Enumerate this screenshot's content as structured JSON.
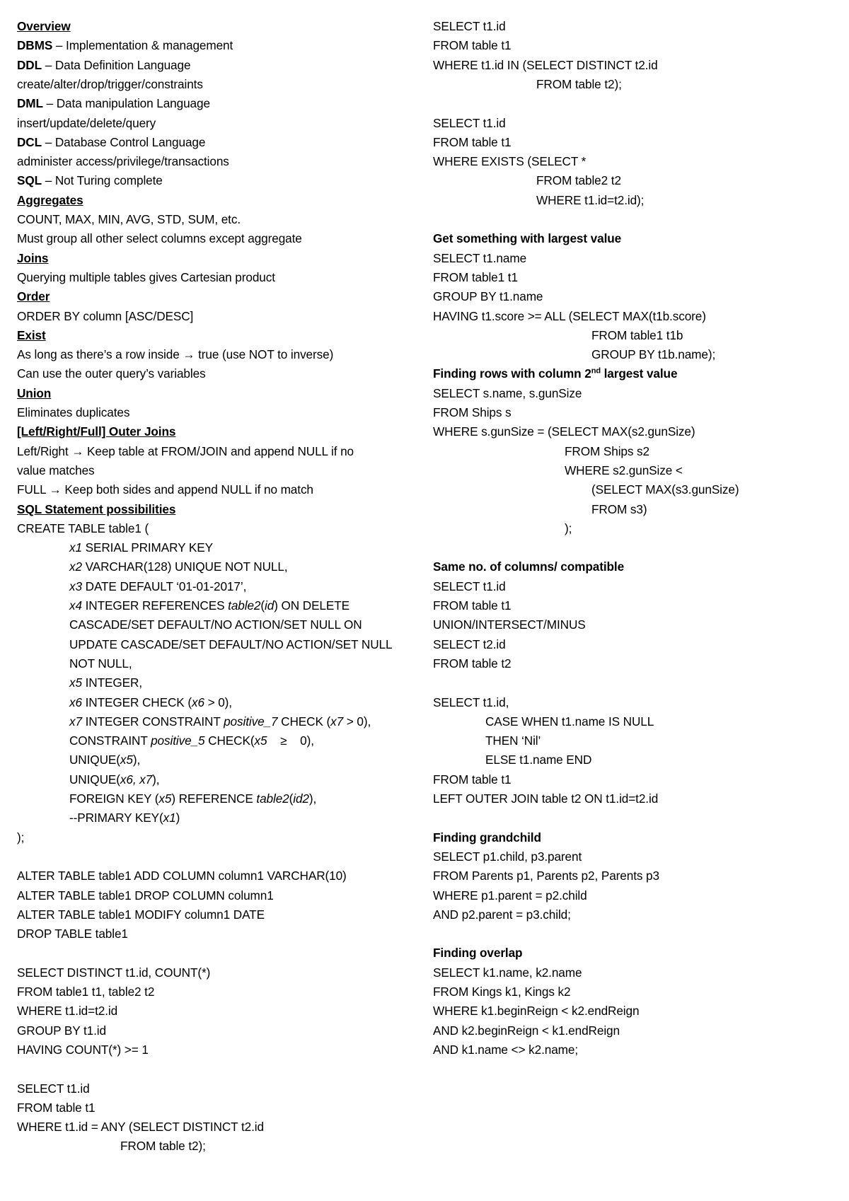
{
  "left_column": [
    {
      "indent": 0,
      "segments": [
        {
          "t": "Overview",
          "b": true,
          "u": true
        }
      ]
    },
    {
      "indent": 0,
      "segments": [
        {
          "t": "DBMS",
          "b": true
        },
        {
          "t": " – Implementation & management"
        }
      ]
    },
    {
      "indent": 0,
      "segments": [
        {
          "t": "DDL",
          "b": true
        },
        {
          "t": " – Data Definition Language"
        }
      ]
    },
    {
      "indent": 0,
      "segments": [
        {
          "t": "create/alter/drop/trigger/constraints"
        }
      ]
    },
    {
      "indent": 0,
      "segments": [
        {
          "t": "DML",
          "b": true
        },
        {
          "t": " – Data manipulation Language"
        }
      ]
    },
    {
      "indent": 0,
      "segments": [
        {
          "t": "insert/update/delete/query"
        }
      ]
    },
    {
      "indent": 0,
      "segments": [
        {
          "t": "DCL",
          "b": true
        },
        {
          "t": " – Database Control Language"
        }
      ]
    },
    {
      "indent": 0,
      "segments": [
        {
          "t": "administer access/privilege/transactions"
        }
      ]
    },
    {
      "indent": 0,
      "segments": [
        {
          "t": "SQL",
          "b": true
        },
        {
          "t": " – Not Turing complete"
        }
      ]
    },
    {
      "indent": 0,
      "segments": [
        {
          "t": "Aggregates",
          "b": true,
          "u": true
        }
      ]
    },
    {
      "indent": 0,
      "segments": [
        {
          "t": "COUNT, MAX, MIN, AVG, STD, SUM, etc."
        }
      ]
    },
    {
      "indent": 0,
      "segments": [
        {
          "t": "Must group all other select columns except aggregate"
        }
      ]
    },
    {
      "indent": 0,
      "segments": [
        {
          "t": "Joins",
          "b": true,
          "u": true
        }
      ]
    },
    {
      "indent": 0,
      "segments": [
        {
          "t": "Querying multiple tables gives Cartesian product"
        }
      ]
    },
    {
      "indent": 0,
      "segments": [
        {
          "t": "Order",
          "b": true,
          "u": true
        }
      ]
    },
    {
      "indent": 0,
      "segments": [
        {
          "t": "ORDER BY column [ASC/DESC]"
        }
      ]
    },
    {
      "indent": 0,
      "segments": [
        {
          "t": "Exist",
          "b": true,
          "u": true
        }
      ]
    },
    {
      "indent": 0,
      "segments": [
        {
          "t": "As long as there’s a row inside → true (use NOT to inverse)"
        }
      ]
    },
    {
      "indent": 0,
      "segments": [
        {
          "t": "Can use the outer query’s variables"
        }
      ]
    },
    {
      "indent": 0,
      "segments": [
        {
          "t": "Union",
          "b": true,
          "u": true
        }
      ]
    },
    {
      "indent": 0,
      "segments": [
        {
          "t": "Eliminates duplicates"
        }
      ]
    },
    {
      "indent": 0,
      "segments": [
        {
          "t": "[Left/Right/Full] Outer Joins",
          "b": true,
          "u": true
        }
      ]
    },
    {
      "indent": 0,
      "segments": [
        {
          "t": "Left/Right → Keep table at FROM/JOIN and append NULL if no"
        }
      ]
    },
    {
      "indent": 0,
      "segments": [
        {
          "t": "value matches"
        }
      ]
    },
    {
      "indent": 0,
      "segments": [
        {
          "t": "FULL → Keep both sides and append NULL if no match"
        }
      ]
    },
    {
      "indent": 0,
      "segments": [
        {
          "t": "SQL Statement possibilities",
          "b": true,
          "u": true
        }
      ]
    },
    {
      "indent": 0,
      "segments": [
        {
          "t": "CREATE TABLE table1 ("
        }
      ]
    },
    {
      "indent": 1,
      "segments": [
        {
          "t": "x1",
          "i": true
        },
        {
          "t": " SERIAL PRIMARY KEY"
        }
      ]
    },
    {
      "indent": 1,
      "segments": [
        {
          "t": "x2",
          "i": true
        },
        {
          "t": " VARCHAR(128) UNIQUE NOT NULL,"
        }
      ]
    },
    {
      "indent": 1,
      "segments": [
        {
          "t": "x3",
          "i": true
        },
        {
          "t": " DATE DEFAULT ‘01-01-2017’,"
        }
      ]
    },
    {
      "indent": 1,
      "segments": [
        {
          "t": "x4",
          "i": true
        },
        {
          "t": " INTEGER REFERENCES "
        },
        {
          "t": "table2",
          "i": true
        },
        {
          "t": "("
        },
        {
          "t": "id",
          "i": true
        },
        {
          "t": ") ON DELETE"
        }
      ]
    },
    {
      "indent": 1,
      "segments": [
        {
          "t": "CASCADE/SET DEFAULT/NO ACTION/SET NULL ON"
        }
      ]
    },
    {
      "indent": 1,
      "segments": [
        {
          "t": "UPDATE CASCADE/SET DEFAULT/NO ACTION/SET NULL"
        }
      ]
    },
    {
      "indent": 1,
      "segments": [
        {
          "t": "NOT NULL,"
        }
      ]
    },
    {
      "indent": 1,
      "segments": [
        {
          "t": "x5",
          "i": true
        },
        {
          "t": " INTEGER,"
        }
      ]
    },
    {
      "indent": 1,
      "segments": [
        {
          "t": "x6",
          "i": true
        },
        {
          "t": " INTEGER CHECK ("
        },
        {
          "t": "x6",
          "i": true
        },
        {
          "t": " > 0),"
        }
      ]
    },
    {
      "indent": 1,
      "segments": [
        {
          "t": "x7",
          "i": true
        },
        {
          "t": " INTEGER CONSTRAINT "
        },
        {
          "t": "positive_7",
          "i": true
        },
        {
          "t": " CHECK ("
        },
        {
          "t": "x7",
          "i": true
        },
        {
          "t": " > 0),"
        }
      ]
    },
    {
      "indent": 1,
      "segments": [
        {
          "t": "CONSTRAINT "
        },
        {
          "t": "positive_5",
          "i": true
        },
        {
          "t": " CHECK("
        },
        {
          "t": "x5",
          "i": true
        },
        {
          "t": "    ≥    0),"
        }
      ]
    },
    {
      "indent": 1,
      "segments": [
        {
          "t": "UNIQUE("
        },
        {
          "t": "x5",
          "i": true
        },
        {
          "t": "),"
        }
      ]
    },
    {
      "indent": 1,
      "segments": [
        {
          "t": "UNIQUE("
        },
        {
          "t": "x6, x7",
          "i": true
        },
        {
          "t": "),"
        }
      ]
    },
    {
      "indent": 1,
      "segments": [
        {
          "t": "FOREIGN KEY ("
        },
        {
          "t": "x5",
          "i": true
        },
        {
          "t": ") REFERENCE "
        },
        {
          "t": "table2",
          "i": true
        },
        {
          "t": "("
        },
        {
          "t": "id2",
          "i": true
        },
        {
          "t": "),"
        }
      ]
    },
    {
      "indent": 1,
      "segments": [
        {
          "t": "--PRIMARY KEY("
        },
        {
          "t": "x1",
          "i": true
        },
        {
          "t": ")"
        }
      ]
    },
    {
      "indent": 0,
      "segments": [
        {
          "t": ");"
        }
      ]
    },
    {
      "indent": 0,
      "segments": []
    },
    {
      "indent": 0,
      "segments": [
        {
          "t": "ALTER TABLE table1 ADD COLUMN column1 VARCHAR(10)"
        }
      ]
    },
    {
      "indent": 0,
      "segments": [
        {
          "t": "ALTER TABLE table1 DROP COLUMN column1"
        }
      ]
    },
    {
      "indent": 0,
      "segments": [
        {
          "t": "ALTER TABLE table1 MODIFY column1 DATE"
        }
      ]
    },
    {
      "indent": 0,
      "segments": [
        {
          "t": "DROP TABLE table1"
        }
      ]
    },
    {
      "indent": 0,
      "segments": []
    },
    {
      "indent": 0,
      "segments": [
        {
          "t": "SELECT DISTINCT t1.id, COUNT(*)"
        }
      ]
    },
    {
      "indent": 0,
      "segments": [
        {
          "t": "FROM table1 t1, table2 t2"
        }
      ]
    },
    {
      "indent": 0,
      "segments": [
        {
          "t": "WHERE t1.id=t2.id"
        }
      ]
    },
    {
      "indent": 0,
      "segments": [
        {
          "t": "GROUP BY t1.id"
        }
      ]
    },
    {
      "indent": 0,
      "segments": [
        {
          "t": "HAVING COUNT(*) >= 1"
        }
      ]
    },
    {
      "indent": 0,
      "segments": []
    },
    {
      "indent": 0,
      "segments": [
        {
          "t": "SELECT t1.id"
        }
      ]
    },
    {
      "indent": 0,
      "segments": [
        {
          "t": "FROM table t1"
        }
      ]
    },
    {
      "indent": 0,
      "segments": [
        {
          "t": "WHERE t1.id = ANY (SELECT DISTINCT t2.id"
        }
      ]
    },
    {
      "indent": 3,
      "segments": [
        {
          "t": "FROM table t2);"
        }
      ]
    }
  ],
  "right_column": [
    {
      "indent": 0,
      "segments": [
        {
          "t": "SELECT t1.id"
        }
      ]
    },
    {
      "indent": 0,
      "segments": [
        {
          "t": "FROM table t1"
        }
      ]
    },
    {
      "indent": 0,
      "segments": [
        {
          "t": "WHERE t1.id IN (SELECT DISTINCT t2.id"
        }
      ]
    },
    {
      "indent": 4,
      "segments": [
        {
          "t": "FROM table t2);"
        }
      ]
    },
    {
      "indent": 0,
      "segments": []
    },
    {
      "indent": 0,
      "segments": [
        {
          "t": "SELECT t1.id"
        }
      ]
    },
    {
      "indent": 0,
      "segments": [
        {
          "t": "FROM table t1"
        }
      ]
    },
    {
      "indent": 0,
      "segments": [
        {
          "t": "WHERE EXISTS (SELECT *"
        }
      ]
    },
    {
      "indent": 4,
      "segments": [
        {
          "t": "FROM table2 t2"
        }
      ]
    },
    {
      "indent": 4,
      "segments": [
        {
          "t": "WHERE t1.id=t2.id);"
        }
      ]
    },
    {
      "indent": 0,
      "segments": []
    },
    {
      "indent": 0,
      "segments": [
        {
          "t": "Get something with largest value",
          "b": true
        }
      ]
    },
    {
      "indent": 0,
      "segments": [
        {
          "t": "SELECT t1.name"
        }
      ]
    },
    {
      "indent": 0,
      "segments": [
        {
          "t": "FROM table1 t1"
        }
      ]
    },
    {
      "indent": 0,
      "segments": [
        {
          "t": "GROUP BY t1.name"
        }
      ]
    },
    {
      "indent": 0,
      "segments": [
        {
          "t": "HAVING t1.score >= ALL (SELECT MAX(t1b.score)"
        }
      ]
    },
    {
      "indent": 6,
      "segments": [
        {
          "t": "FROM table1 t1b"
        }
      ]
    },
    {
      "indent": 6,
      "segments": [
        {
          "t": "GROUP BY t1b.name);"
        }
      ]
    },
    {
      "indent": 0,
      "segments": [
        {
          "t": "Finding rows with column 2",
          "b": true
        },
        {
          "t": "nd",
          "b": true,
          "sup": true
        },
        {
          "t": " largest value",
          "b": true
        }
      ]
    },
    {
      "indent": 0,
      "segments": [
        {
          "t": "SELECT s.name, s.gunSize"
        }
      ]
    },
    {
      "indent": 0,
      "segments": [
        {
          "t": "FROM Ships s"
        }
      ]
    },
    {
      "indent": 0,
      "segments": [
        {
          "t": "WHERE s.gunSize = (SELECT MAX(s2.gunSize)"
        }
      ]
    },
    {
      "indent": 5,
      "segments": [
        {
          "t": "FROM Ships s2"
        }
      ]
    },
    {
      "indent": 5,
      "segments": [
        {
          "t": "WHERE s2.gunSize <"
        }
      ]
    },
    {
      "indent": 6,
      "segments": [
        {
          "t": "(SELECT MAX(s3.gunSize)"
        }
      ]
    },
    {
      "indent": 6,
      "segments": [
        {
          "t": "FROM s3)"
        }
      ]
    },
    {
      "indent": 5,
      "segments": [
        {
          "t": ");"
        }
      ]
    },
    {
      "indent": 0,
      "segments": []
    },
    {
      "indent": 0,
      "segments": [
        {
          "t": "Same no. of columns/ compatible",
          "b": true
        }
      ]
    },
    {
      "indent": 0,
      "segments": [
        {
          "t": "SELECT t1.id"
        }
      ]
    },
    {
      "indent": 0,
      "segments": [
        {
          "t": "FROM table t1"
        }
      ]
    },
    {
      "indent": 0,
      "segments": [
        {
          "t": "UNION/INTERSECT/MINUS"
        }
      ]
    },
    {
      "indent": 0,
      "segments": [
        {
          "t": "SELECT t2.id"
        }
      ]
    },
    {
      "indent": 0,
      "segments": [
        {
          "t": "FROM table t2"
        }
      ]
    },
    {
      "indent": 0,
      "segments": []
    },
    {
      "indent": 0,
      "segments": [
        {
          "t": "SELECT t1.id,"
        }
      ]
    },
    {
      "indent": 2,
      "segments": [
        {
          "t": "CASE WHEN t1.name IS NULL"
        }
      ]
    },
    {
      "indent": 2,
      "segments": [
        {
          "t": "THEN ‘Nil’"
        }
      ]
    },
    {
      "indent": 2,
      "segments": [
        {
          "t": "ELSE t1.name END"
        }
      ]
    },
    {
      "indent": 0,
      "segments": [
        {
          "t": "FROM table t1"
        }
      ]
    },
    {
      "indent": 0,
      "segments": [
        {
          "t": "LEFT OUTER JOIN table t2 ON t1.id=t2.id"
        }
      ]
    },
    {
      "indent": 0,
      "segments": []
    },
    {
      "indent": 0,
      "segments": [
        {
          "t": "Finding grandchild",
          "b": true
        }
      ]
    },
    {
      "indent": 0,
      "segments": [
        {
          "t": "SELECT p1.child, p3.parent"
        }
      ]
    },
    {
      "indent": 0,
      "segments": [
        {
          "t": "FROM Parents p1, Parents p2, Parents p3"
        }
      ]
    },
    {
      "indent": 0,
      "segments": [
        {
          "t": "WHERE p1.parent = p2.child"
        }
      ]
    },
    {
      "indent": 0,
      "segments": [
        {
          "t": "AND p2.parent = p3.child;"
        }
      ]
    },
    {
      "indent": 0,
      "segments": []
    },
    {
      "indent": 0,
      "segments": [
        {
          "t": "Finding overlap",
          "b": true
        }
      ]
    },
    {
      "indent": 0,
      "segments": [
        {
          "t": "SELECT k1.name, k2.name"
        }
      ]
    },
    {
      "indent": 0,
      "segments": [
        {
          "t": "FROM Kings k1, Kings k2"
        }
      ]
    },
    {
      "indent": 0,
      "segments": [
        {
          "t": "WHERE k1.beginReign < k2.endReign"
        }
      ]
    },
    {
      "indent": 0,
      "segments": [
        {
          "t": "AND k2.beginReign < k1.endReign"
        }
      ]
    },
    {
      "indent": 0,
      "segments": [
        {
          "t": "AND k1.name <> k2.name;"
        }
      ]
    }
  ]
}
